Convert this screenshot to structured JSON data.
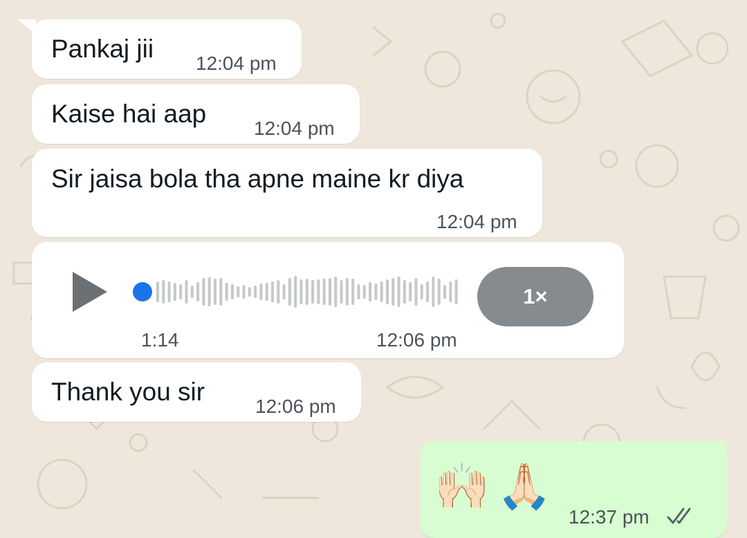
{
  "chat": {
    "messages": [
      {
        "text": "Pankaj jii",
        "time": "12:04 pm"
      },
      {
        "text": "Kaise hai aap",
        "time": "12:04 pm"
      },
      {
        "text": "Sir jaisa bola tha apne maine kr diya",
        "time": "12:04 pm"
      },
      {
        "text": "Thank you sir",
        "time": "12:06 pm"
      }
    ],
    "voice_note": {
      "duration": "1:14",
      "time": "12:06 pm",
      "speed": "1×",
      "progress": 0
    },
    "outgoing": {
      "emoji_1": "🙌🏻",
      "emoji_2": "🙏🏻",
      "time": "12:37 pm",
      "status_icon": "double-check-icon"
    }
  },
  "colors": {
    "wallpaper": "#efe7dc",
    "incoming_bubble": "#ffffff",
    "outgoing_bubble": "#d8fdd2",
    "progress_dot": "#1a73e8",
    "speed_button": "#858b8f"
  }
}
